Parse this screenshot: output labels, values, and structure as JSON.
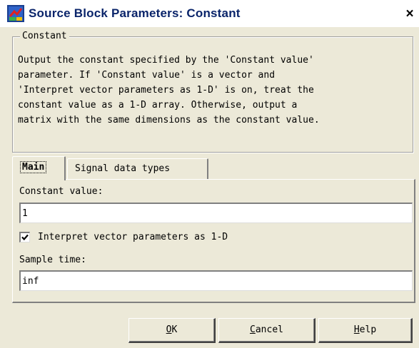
{
  "window": {
    "title": "Source Block Parameters: Constant",
    "close_glyph": "×"
  },
  "description_group": {
    "legend": "Constant",
    "text": "Output the constant specified by the 'Constant value'\nparameter. If 'Constant value' is a vector and\n'Interpret vector parameters as 1-D' is on, treat the\nconstant value as a 1-D array. Otherwise, output a\nmatrix with the same dimensions as the constant value."
  },
  "tabs": [
    {
      "label": "Main",
      "selected": true
    },
    {
      "label": "Signal data types",
      "selected": false
    }
  ],
  "main_panel": {
    "constant_value_label": "Constant value:",
    "constant_value": "1",
    "interpret_checkbox_label": "Interpret vector parameters as 1-D",
    "interpret_checked": true,
    "sample_time_label": "Sample time:",
    "sample_time_value": "inf"
  },
  "buttons": {
    "ok": {
      "mnemonic": "O",
      "rest": "K"
    },
    "cancel": {
      "mnemonic": "C",
      "rest": "ancel"
    },
    "help": {
      "mnemonic": "H",
      "rest": "elp"
    }
  },
  "colors": {
    "dialog_background": "#ece9d8",
    "title_text": "#0a246a"
  }
}
